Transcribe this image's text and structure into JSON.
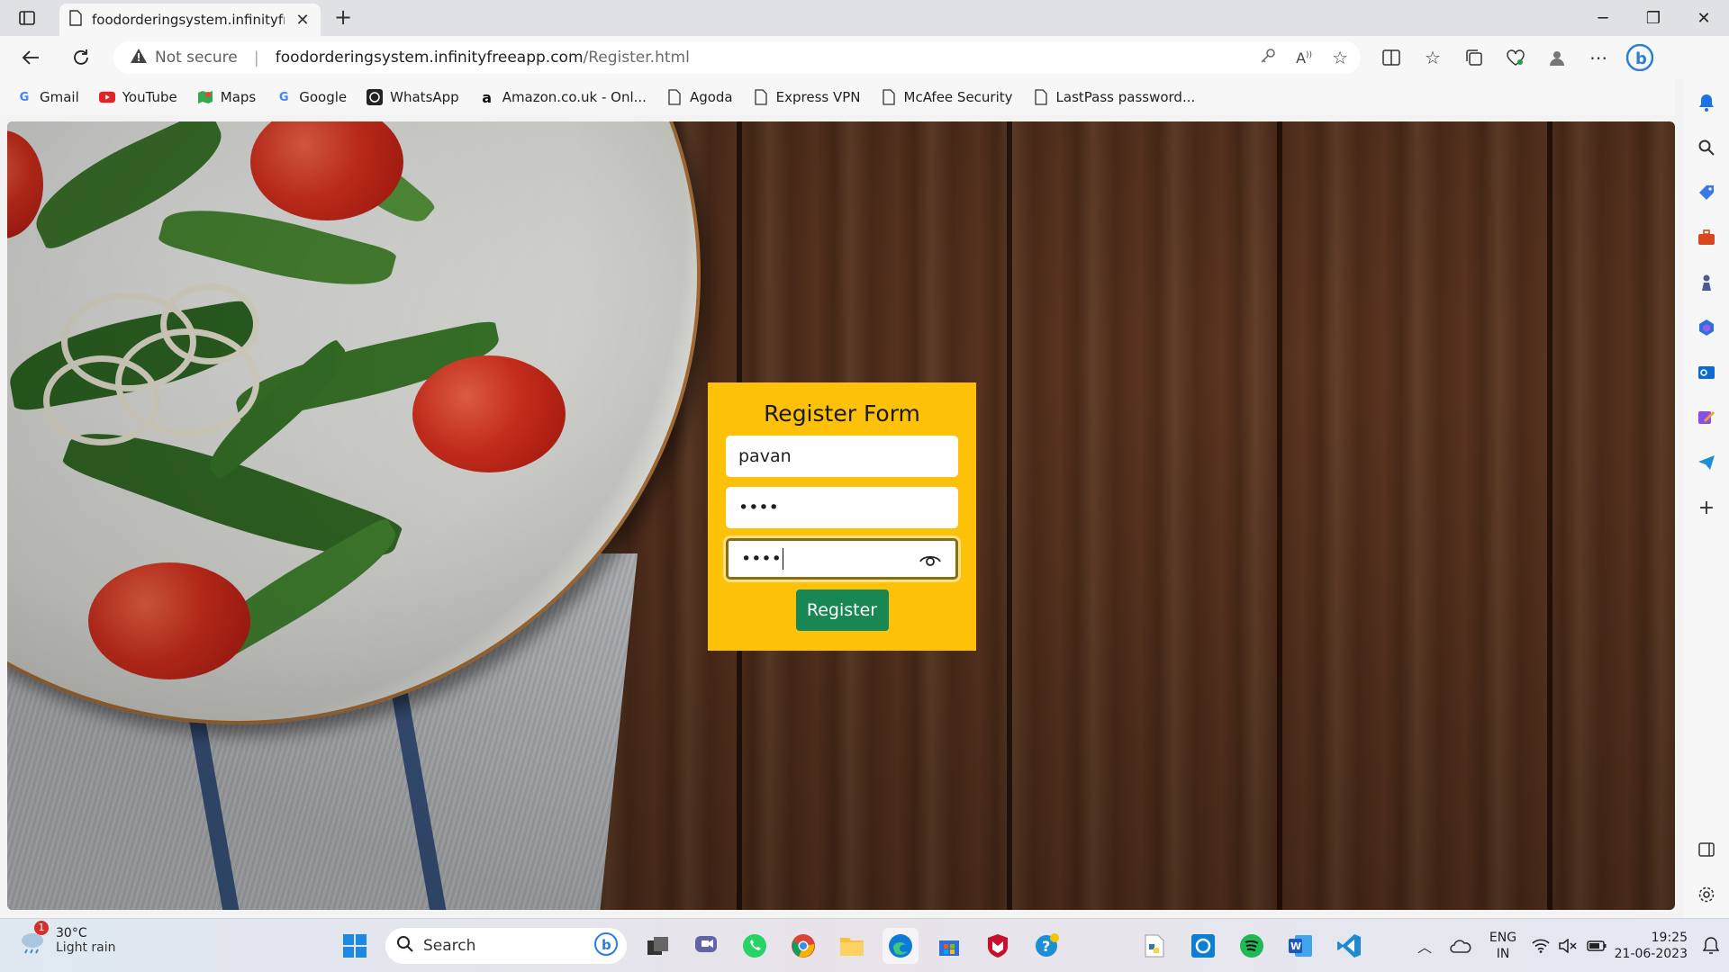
{
  "browser": {
    "tab_title": "foodorderingsystem.infinityfreeapp.com",
    "security_label": "Not secure",
    "url_host": "foodorderingsystem.infinityfreeapp.com",
    "url_path": "/Register.html"
  },
  "favorites": [
    {
      "label": "Gmail",
      "icon": "google-g-icon"
    },
    {
      "label": "YouTube",
      "icon": "youtube-icon"
    },
    {
      "label": "Maps",
      "icon": "maps-icon"
    },
    {
      "label": "Google",
      "icon": "google-g-icon"
    },
    {
      "label": "WhatsApp",
      "icon": "whatsapp-icon"
    },
    {
      "label": "Amazon.co.uk - Onl...",
      "icon": "amazon-icon"
    },
    {
      "label": "Agoda",
      "icon": "page-icon"
    },
    {
      "label": "Express VPN",
      "icon": "page-icon"
    },
    {
      "label": "McAfee Security",
      "icon": "page-icon"
    },
    {
      "label": "LastPass password...",
      "icon": "page-icon"
    }
  ],
  "form": {
    "title": "Register Form",
    "username_value": "pavan",
    "password_value": "••••",
    "confirm_password_value": "••••",
    "submit_label": "Register"
  },
  "taskbar": {
    "weather_temp": "30°C",
    "weather_desc": "Light rain",
    "weather_badge": "1",
    "search_placeholder": "Search",
    "lang_line1": "ENG",
    "lang_line2": "IN",
    "time": "19:25",
    "date": "21-06-2023"
  },
  "colors": {
    "form_background": "#fdc10a",
    "register_button": "#198754",
    "wood": "#4b2b19"
  }
}
